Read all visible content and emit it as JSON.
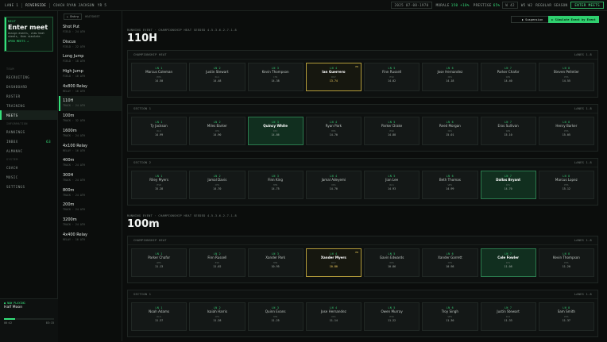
{
  "topbar": {
    "brand": "LANE 1",
    "school": "RIVERSIDE",
    "coach": "COACH RYAN JACKSON",
    "grade": "YR 5",
    "date": "2025 07-08-1970",
    "morale_label": "MORALE",
    "morale": "150 +10%",
    "prestige_label": "PRESTIGE",
    "prestige": "65%",
    "record": "W 42",
    "record2": "W5 W2",
    "season": "REGULAR SEASON",
    "enter_meets": "ENTER MEETS"
  },
  "sidebar": {
    "next": {
      "label": "NEXT",
      "title": "Enter meet",
      "desc": "Assign events, view heat sheets, then simulate.",
      "link": "OPEN MEETS →"
    },
    "nav": [
      {
        "label": "TEAM",
        "type": "group"
      },
      {
        "label": "RECRUITING",
        "type": "item"
      },
      {
        "label": "DASHBOARD",
        "type": "item"
      },
      {
        "label": "ROSTER",
        "type": "item"
      },
      {
        "label": "TRAINING",
        "type": "item"
      },
      {
        "label": "MEETS",
        "type": "active"
      },
      {
        "label": "INFORMATION",
        "type": "group"
      },
      {
        "label": "RANKINGS",
        "type": "item"
      },
      {
        "label": "INBOX",
        "type": "item",
        "badge": "63"
      },
      {
        "label": "ALMANAC",
        "type": "item"
      },
      {
        "label": "SYSTEM",
        "type": "group"
      },
      {
        "label": "COACH",
        "type": "item"
      },
      {
        "label": "MUSIC",
        "type": "item"
      },
      {
        "label": "SETTINGS",
        "type": "item"
      }
    ],
    "now_playing": {
      "label": "● NOW PLAYING",
      "song": "Half Moon",
      "progress": 0.22,
      "elapsed": "00:42",
      "total": "03:15"
    }
  },
  "events_panel": {
    "entry_button": "← Entry",
    "heading": "HEATSHEET",
    "events": [
      {
        "name": "Shot Put",
        "meta": "FIELD · 24 ATH"
      },
      {
        "name": "Discus",
        "meta": "FIELD · 22 ATH"
      },
      {
        "name": "Long Jump",
        "meta": "FIELD · 18 ATH"
      },
      {
        "name": "High Jump",
        "meta": "FIELD · 16 ATH"
      },
      {
        "name": "4x800 Relay",
        "meta": "RELAY · 16 ATH"
      },
      {
        "name": "110H",
        "meta": "TRACK · 24 ATH",
        "active": true
      },
      {
        "name": "100m",
        "meta": "TRACK · 32 ATH"
      },
      {
        "name": "1600m",
        "meta": "TRACK · 24 ATH"
      },
      {
        "name": "4x100 Relay",
        "meta": "RELAY · 16 ATH"
      },
      {
        "name": "400m",
        "meta": "TRACK · 24 ATH"
      },
      {
        "name": "300H",
        "meta": "TRACK · 24 ATH"
      },
      {
        "name": "800m",
        "meta": "TRACK · 24 ATH"
      },
      {
        "name": "200m",
        "meta": "TRACK · 24 ATH"
      },
      {
        "name": "3200m",
        "meta": "TRACK · 24 ATH"
      },
      {
        "name": "4x400 Relay",
        "meta": "RELAY · 16 ATH"
      }
    ]
  },
  "actions": {
    "suspension": "▮ Suspension",
    "simulate": "▶ Simulate Event by Event"
  },
  "blocks": [
    {
      "kicker": "RUNNING EVENT · CHAMPIONSHIP HEAT SEEDED 4-5-3-6-2-7-1-8",
      "title": "110H",
      "heats": [
        {
          "name": "CHAMPIONSHIP HEAT",
          "lanes_label": "LANES 1-8",
          "lanes": [
            {
              "lane": "LN 1",
              "athlete": "Marcus Coleman",
              "school": "HHS",
              "time": "14.50"
            },
            {
              "lane": "LN 2",
              "athlete": "Justin Stewart",
              "school": "RLS",
              "time": "14.48"
            },
            {
              "lane": "LN 3",
              "athlete": "Kevin Thompson",
              "school": "CHS",
              "time": "14.38"
            },
            {
              "lane": "LN 4",
              "athlete": "Ian Guerrero",
              "school": "RIV",
              "time": "13.74",
              "style": "gold",
              "badge": "PR"
            },
            {
              "lane": "LN 5",
              "athlete": "Finn Russell",
              "school": "ESD",
              "time": "14.02"
            },
            {
              "lane": "LN 6",
              "athlete": "Jose Hernandez",
              "school": "OKS",
              "time": "14.18"
            },
            {
              "lane": "LN 7",
              "athlete": "Parker Chafor",
              "school": "WHS",
              "time": "14.40"
            },
            {
              "lane": "LN 8",
              "athlete": "Steven Pelletier",
              "school": "PHS",
              "time": "14.55"
            }
          ]
        },
        {
          "name": "SECTION 1",
          "lanes_label": "LANES 1-8",
          "lanes": [
            {
              "lane": "LN 1",
              "athlete": "Ty Jackson",
              "school": "RLS",
              "time": "14.99"
            },
            {
              "lane": "LN 2",
              "athlete": "Miles Barker",
              "school": "CHS",
              "time": "14.90"
            },
            {
              "lane": "LN 3",
              "athlete": "Quincy White",
              "school": "RIV",
              "time": "14.86",
              "style": "green"
            },
            {
              "lane": "LN 4",
              "athlete": "Ryan Park",
              "school": "HHS",
              "time": "14.70"
            },
            {
              "lane": "LN 5",
              "athlete": "Parker Drake",
              "school": "ESD",
              "time": "14.88"
            },
            {
              "lane": "LN 6",
              "athlete": "Reed Morgan",
              "school": "OKS",
              "time": "15.01"
            },
            {
              "lane": "LN 7",
              "athlete": "Eros Sullivan",
              "school": "WHS",
              "time": "15.10"
            },
            {
              "lane": "LN 8",
              "athlete": "Henry Barker",
              "school": "PHS",
              "time": "15.05"
            }
          ]
        },
        {
          "name": "SECTION 2",
          "lanes_label": "LANES 1-8",
          "lanes": [
            {
              "lane": "LN 1",
              "athlete": "Riley Myers",
              "school": "ESD",
              "time": "15.28"
            },
            {
              "lane": "LN 2",
              "athlete": "Jamal Davis",
              "school": "CHS",
              "time": "14.70"
            },
            {
              "lane": "LN 3",
              "athlete": "Finn King",
              "school": "HHS",
              "time": "14.75"
            },
            {
              "lane": "LN 4",
              "athlete": "Jamal Adeyemi",
              "school": "OKS",
              "time": "14.70"
            },
            {
              "lane": "LN 5",
              "athlete": "Jian Lee",
              "school": "RLS",
              "time": "14.93"
            },
            {
              "lane": "LN 6",
              "athlete": "Beth Thomas",
              "school": "WHS",
              "time": "14.99"
            },
            {
              "lane": "LN 7",
              "athlete": "Dallas Bryant",
              "school": "RIV",
              "time": "14.70",
              "style": "green"
            },
            {
              "lane": "LN 8",
              "athlete": "Marcus Lopez",
              "school": "PHS",
              "time": "15.12"
            }
          ]
        }
      ]
    },
    {
      "kicker": "RUNNING EVENT · CHAMPIONSHIP HEAT SEEDED 4-5-3-6-2-7-1-8",
      "title": "100m",
      "heats": [
        {
          "name": "CHAMPIONSHIP HEAT",
          "lanes_label": "LANES 1-8",
          "lanes": [
            {
              "lane": "LN 1",
              "athlete": "Parker Chafor",
              "school": "WHS",
              "time": "11.13"
            },
            {
              "lane": "LN 2",
              "athlete": "Finn Russell",
              "school": "ESD",
              "time": "11.02"
            },
            {
              "lane": "LN 3",
              "athlete": "Xander Park",
              "school": "HHS",
              "time": "10.95"
            },
            {
              "lane": "LN 4",
              "athlete": "Xander Myers",
              "school": "RIV",
              "time": "10.80",
              "style": "gold",
              "badge": "PR"
            },
            {
              "lane": "LN 5",
              "athlete": "Gavin Edwards",
              "school": "OKS",
              "time": "10.86"
            },
            {
              "lane": "LN 6",
              "athlete": "Xander Garrett",
              "school": "CHS",
              "time": "10.98"
            },
            {
              "lane": "LN 7",
              "athlete": "Cole Fowler",
              "school": "RIV",
              "time": "11.08",
              "style": "green"
            },
            {
              "lane": "LN 8",
              "athlete": "Kevin Thompson",
              "school": "PHS",
              "time": "11.20"
            }
          ]
        },
        {
          "name": "SECTION 1",
          "lanes_label": "LANES 1-8",
          "lanes": [
            {
              "lane": "LN 1",
              "athlete": "Noah Adams",
              "school": "RLS",
              "time": "11.37"
            },
            {
              "lane": "LN 2",
              "athlete": "Isaiah Harris",
              "school": "CHS",
              "time": "11.28"
            },
            {
              "lane": "LN 3",
              "athlete": "Quinn Evans",
              "school": "HHS",
              "time": "11.25"
            },
            {
              "lane": "LN 4",
              "athlete": "Jose Hernandez",
              "school": "OKS",
              "time": "11.14"
            },
            {
              "lane": "LN 5",
              "athlete": "Owen Murray",
              "school": "ESD",
              "time": "11.22"
            },
            {
              "lane": "LN 6",
              "athlete": "Troy Singh",
              "school": "WHS",
              "time": "11.30"
            },
            {
              "lane": "LN 7",
              "athlete": "Justin Stewart",
              "school": "RLS",
              "time": "11.33"
            },
            {
              "lane": "LN 8",
              "athlete": "Sam Smith",
              "school": "PHS",
              "time": "11.37"
            }
          ]
        }
      ]
    }
  ]
}
